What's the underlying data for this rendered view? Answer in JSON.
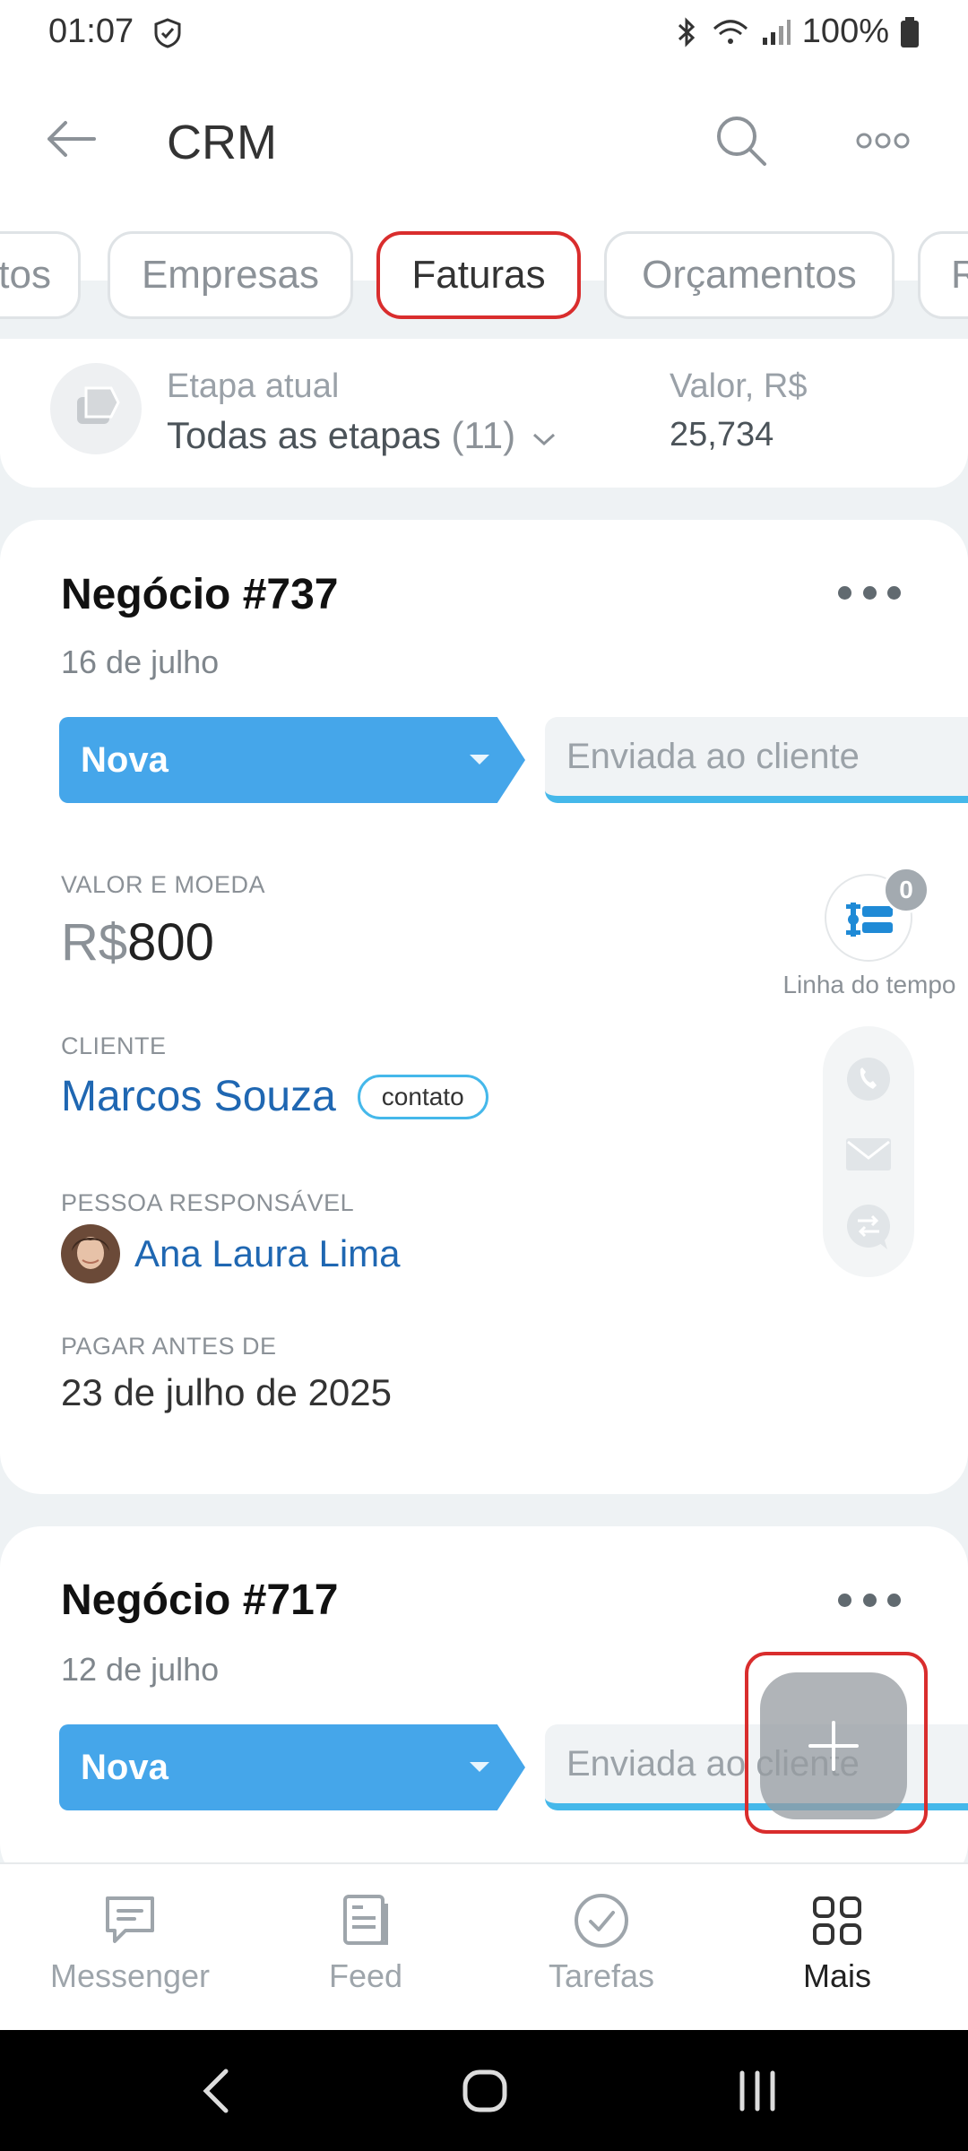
{
  "status": {
    "time": "01:07",
    "battery": "100%"
  },
  "header": {
    "title": "CRM"
  },
  "tabs": [
    {
      "label": "tos"
    },
    {
      "label": "Empresas"
    },
    {
      "label": "Faturas"
    },
    {
      "label": "Orçamentos"
    },
    {
      "label": "R"
    }
  ],
  "summary": {
    "stage_label": "Etapa atual",
    "stage_value": "Todas as etapas",
    "stage_count": "(11)",
    "value_label": "Valor, R$",
    "value": "25,734"
  },
  "deals": [
    {
      "title": "Negócio #737",
      "date": "16 de julho",
      "stage": "Nova",
      "next_stage": "Enviada ao cliente",
      "amount_label": "VALOR E MOEDA",
      "currency": "R$",
      "amount": "800",
      "client_label": "CLIENTE",
      "client": "Marcos Souza",
      "client_badge": "contato",
      "responsible_label": "PESSOA RESPONSÁVEL",
      "responsible": "Ana Laura Lima",
      "due_label": "PAGAR ANTES DE",
      "due": "23 de julho de 2025"
    },
    {
      "title": "Negócio #717",
      "date": "12 de julho",
      "stage": "Nova",
      "next_stage": "Enviada ao cliente"
    }
  ],
  "timeline": {
    "count": "0",
    "label": "Linha do tempo"
  },
  "bottom_nav": [
    {
      "label": "Messenger",
      "icon": "chat-icon"
    },
    {
      "label": "Feed",
      "icon": "feed-icon"
    },
    {
      "label": "Tarefas",
      "icon": "check-circle-icon"
    },
    {
      "label": "Mais",
      "icon": "grid-icon"
    }
  ],
  "colors": {
    "accent_blue": "#45a6ea",
    "link_blue": "#1f67b2",
    "highlight_red": "#d92d2d"
  }
}
